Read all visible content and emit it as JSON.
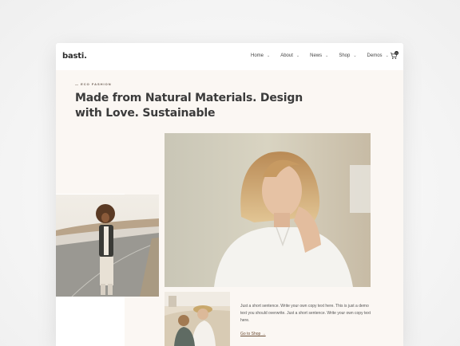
{
  "site": {
    "logo": "basti."
  },
  "nav": {
    "items": [
      {
        "label": "Home"
      },
      {
        "label": "About"
      },
      {
        "label": "News"
      },
      {
        "label": "Shop"
      },
      {
        "label": "Demos"
      }
    ],
    "cart_count": "0"
  },
  "hero": {
    "eyebrow": "— ECO FASHION",
    "headline": "Made from Natural Materials. Design with Love. Sustainable"
  },
  "content": {
    "body": "Just a short sentence. Write your own copy text here. This is just a demo text you should overwrite. Just a short sentence. Write your own copy text here.",
    "cta": "Go to Shop →"
  },
  "icons": {
    "nav_chevron": "chevron-down-icon",
    "cart": "cart-icon"
  },
  "colors": {
    "accent_beige": "#fbf7f3",
    "headline": "#3b3b3b",
    "link": "#6a4b32"
  }
}
